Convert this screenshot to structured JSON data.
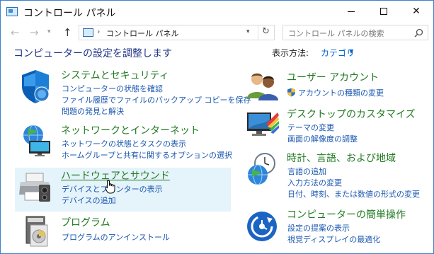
{
  "window": {
    "title": "コントロール パネル"
  },
  "address": {
    "path": "コントロール パネル",
    "search_placeholder": "コントロール パネルの検索"
  },
  "header": {
    "heading": "コンピューターの設定を調整します",
    "view_by_label": "表示方法:",
    "view_by_value": "カテゴリ"
  },
  "left_categories": [
    {
      "title": "システムとセキュリティ",
      "links": [
        "コンピューターの状態を確認",
        "ファイル履歴でファイルのバックアップ コピーを保存",
        "問題の発見と解決"
      ]
    },
    {
      "title": "ネットワークとインターネット",
      "links": [
        "ネットワークの状態とタスクの表示",
        "ホームグループと共有に関するオプションの選択"
      ]
    },
    {
      "title": "ハードウェアとサウンド",
      "links": [
        "デバイスとプリンターの表示",
        "デバイスの追加"
      ]
    },
    {
      "title": "プログラム",
      "links": [
        "プログラムのアンインストール"
      ]
    }
  ],
  "right_categories": [
    {
      "title": "ユーザー アカウント",
      "links": [
        "アカウントの種類の変更"
      ]
    },
    {
      "title": "デスクトップのカスタマイズ",
      "links": [
        "テーマの変更",
        "画面の解像度の調整"
      ]
    },
    {
      "title": "時計、言語、および地域",
      "links": [
        "言語の追加",
        "入力方法の変更",
        "日付、時刻、または数値の形式の変更"
      ]
    },
    {
      "title": "コンピューターの簡単操作",
      "links": [
        "設定の提案の表示",
        "視覚ディスプレイの最適化"
      ]
    }
  ],
  "colors": {
    "category_title": "#217a21",
    "link": "#1a57b0",
    "heading": "#1e3287",
    "hover_background": "#e5f3fb"
  }
}
